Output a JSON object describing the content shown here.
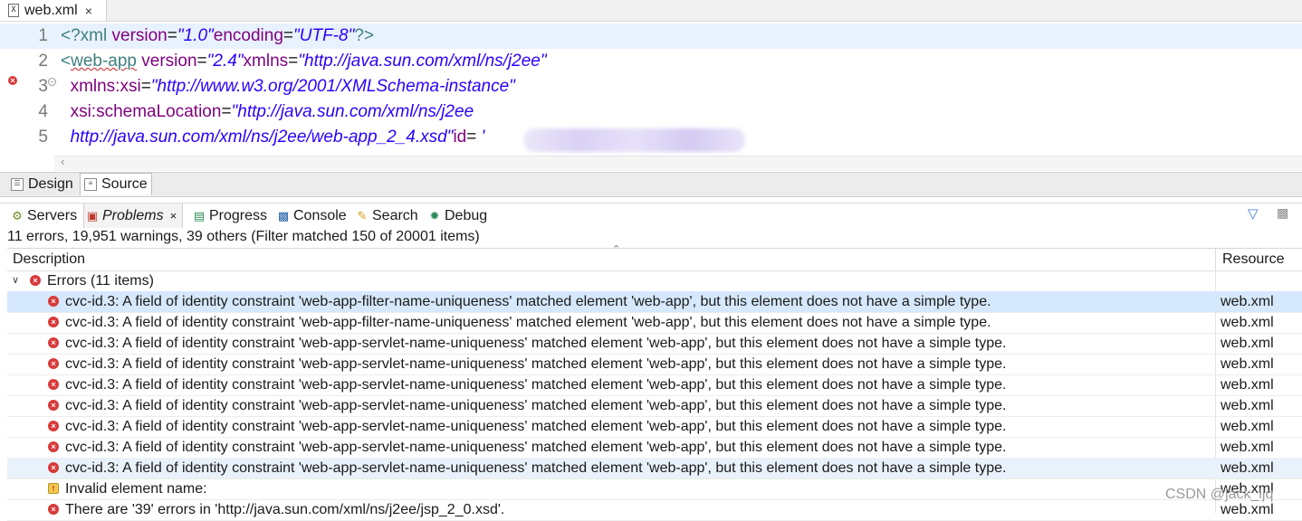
{
  "editor_tab": {
    "title": "web.xml",
    "close": "×"
  },
  "code_lines": [
    {
      "num": "1",
      "parts": [
        [
          "tag",
          "<?xml "
        ],
        [
          "attr",
          "version"
        ],
        [
          "plain",
          "="
        ],
        [
          "val",
          "\"1.0\""
        ],
        [
          "attr",
          "encoding"
        ],
        [
          "plain",
          "="
        ],
        [
          "val",
          "\"UTF-8\""
        ],
        [
          "tag",
          "?>"
        ]
      ]
    },
    {
      "num": "2",
      "parts": [
        [
          "tag",
          "<"
        ],
        [
          "tagerr",
          "web-app"
        ],
        [
          "plain",
          " "
        ],
        [
          "attr",
          "version"
        ],
        [
          "plain",
          "="
        ],
        [
          "val",
          "\"2.4\""
        ],
        [
          "attr",
          "xmlns"
        ],
        [
          "plain",
          "="
        ],
        [
          "val",
          "\"http://java.sun.com/xml/ns/j2ee\""
        ]
      ]
    },
    {
      "num": "3",
      "parts": [
        [
          "plain",
          "  "
        ],
        [
          "attr",
          "xmlns:xsi"
        ],
        [
          "plain",
          "="
        ],
        [
          "val",
          "\"http://www.w3.org/2001/XMLSchema-instance\""
        ]
      ]
    },
    {
      "num": "4",
      "parts": [
        [
          "plain",
          "  "
        ],
        [
          "attr",
          "xsi:schemaLocation"
        ],
        [
          "plain",
          "="
        ],
        [
          "val",
          "\"http://java.sun.com/xml/ns/j2ee"
        ]
      ]
    },
    {
      "num": "5",
      "parts": [
        [
          "plain",
          "  "
        ],
        [
          "val",
          "http://java.sun.com/xml/ns/j2ee/web-app_2_4.xsd\""
        ],
        [
          "attr",
          "id"
        ],
        [
          "plain",
          "= "
        ],
        [
          "val",
          "'"
        ]
      ]
    }
  ],
  "editor_modes": {
    "design": "Design",
    "source": "Source"
  },
  "views": {
    "servers": "Servers",
    "problems": "Problems",
    "progress": "Progress",
    "console": "Console",
    "search": "Search",
    "debug": "Debug",
    "close": "×"
  },
  "problems": {
    "summary": "11 errors, 19,951 warnings, 39 others (Filter matched 150 of 20001 items)",
    "columns": {
      "description": "Description",
      "resource": "Resource"
    },
    "group_label": "Errors (11 items)",
    "rows": [
      {
        "icon": "error",
        "description": "cvc-id.3: A field of identity constraint 'web-app-filter-name-uniqueness' matched element 'web-app', but this element does not have a simple type.",
        "resource": "web.xml",
        "state": "selected"
      },
      {
        "icon": "error",
        "description": "cvc-id.3: A field of identity constraint 'web-app-filter-name-uniqueness' matched element 'web-app', but this element does not have a simple type.",
        "resource": "web.xml",
        "state": ""
      },
      {
        "icon": "error",
        "description": "cvc-id.3: A field of identity constraint 'web-app-servlet-name-uniqueness' matched element 'web-app', but this element does not have a simple type.",
        "resource": "web.xml",
        "state": ""
      },
      {
        "icon": "error",
        "description": "cvc-id.3: A field of identity constraint 'web-app-servlet-name-uniqueness' matched element 'web-app', but this element does not have a simple type.",
        "resource": "web.xml",
        "state": ""
      },
      {
        "icon": "error",
        "description": "cvc-id.3: A field of identity constraint 'web-app-servlet-name-uniqueness' matched element 'web-app', but this element does not have a simple type.",
        "resource": "web.xml",
        "state": ""
      },
      {
        "icon": "error",
        "description": "cvc-id.3: A field of identity constraint 'web-app-servlet-name-uniqueness' matched element 'web-app', but this element does not have a simple type.",
        "resource": "web.xml",
        "state": ""
      },
      {
        "icon": "error",
        "description": "cvc-id.3: A field of identity constraint 'web-app-servlet-name-uniqueness' matched element 'web-app', but this element does not have a simple type.",
        "resource": "web.xml",
        "state": ""
      },
      {
        "icon": "error",
        "description": "cvc-id.3: A field of identity constraint 'web-app-servlet-name-uniqueness' matched element 'web-app', but this element does not have a simple type.",
        "resource": "web.xml",
        "state": ""
      },
      {
        "icon": "error",
        "description": "cvc-id.3: A field of identity constraint 'web-app-servlet-name-uniqueness' matched element 'web-app', but this element does not have a simple type.",
        "resource": "web.xml",
        "state": "hl"
      },
      {
        "icon": "warning-error",
        "description": "Invalid element name:",
        "resource": "web.xml",
        "state": ""
      },
      {
        "icon": "error",
        "description": "There are '39' errors in 'http://java.sun.com/xml/ns/j2ee/jsp_2_0.xsd'.",
        "resource": "web.xml",
        "state": ""
      }
    ]
  },
  "watermark": "CSDN @jack_ljq",
  "colors": {
    "tag": "#3f7f7f",
    "attribute": "#7f007f",
    "value": "#2a00ff",
    "error": "#d83a3a",
    "selection": "#d6e8fb"
  }
}
